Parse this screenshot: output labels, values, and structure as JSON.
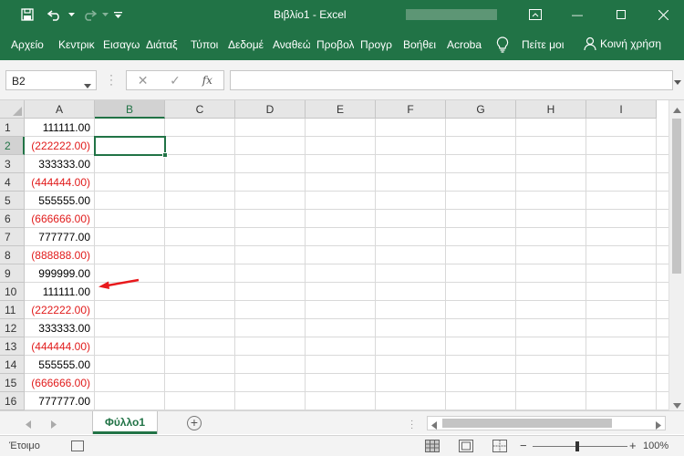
{
  "titlebar": {
    "title": "Βιβλίο1  -  Excel",
    "minimize_glyph": "—",
    "icons": [
      "save-icon",
      "undo-icon",
      "redo-icon",
      "customize-qat-icon",
      "ribbon-display-icon",
      "minimize-icon",
      "maximize-icon",
      "close-icon"
    ]
  },
  "ribbon": {
    "tabs": [
      "Αρχείο",
      "Κεντρικ",
      "Εισαγω",
      "Διάταξ",
      "Τύποι",
      "Δεδομέ",
      "Αναθεώ",
      "Προβολ",
      "Προγρ",
      "Βοήθει",
      "Acroba"
    ],
    "tell_me": "Πείτε μοι",
    "share": "Κοινή χρήση"
  },
  "formula_bar": {
    "name_box": "B2",
    "fx": "fx",
    "value": ""
  },
  "grid": {
    "columns": [
      "A",
      "B",
      "C",
      "D",
      "E",
      "F",
      "G",
      "H",
      "I"
    ],
    "selected_column": "B",
    "selected_row": 2,
    "rows": [
      {
        "n": "1",
        "a": "111111.00",
        "negative": false
      },
      {
        "n": "2",
        "a": "(222222.00)",
        "negative": true
      },
      {
        "n": "3",
        "a": "333333.00",
        "negative": false
      },
      {
        "n": "4",
        "a": "(444444.00)",
        "negative": true
      },
      {
        "n": "5",
        "a": "555555.00",
        "negative": false
      },
      {
        "n": "6",
        "a": "(666666.00)",
        "negative": true
      },
      {
        "n": "7",
        "a": "777777.00",
        "negative": false
      },
      {
        "n": "8",
        "a": "(888888.00)",
        "negative": true
      },
      {
        "n": "9",
        "a": "999999.00",
        "negative": false
      },
      {
        "n": "10",
        "a": "111111.00",
        "negative": false
      },
      {
        "n": "11",
        "a": "(222222.00)",
        "negative": true
      },
      {
        "n": "12",
        "a": "333333.00",
        "negative": false
      },
      {
        "n": "13",
        "a": "(444444.00)",
        "negative": true
      },
      {
        "n": "14",
        "a": "555555.00",
        "negative": false
      },
      {
        "n": "15",
        "a": "(666666.00)",
        "negative": true
      },
      {
        "n": "16",
        "a": "777777.00",
        "negative": false
      }
    ],
    "negative_color": "#e11b1b",
    "annotation_arrow_color": "#e8191c"
  },
  "sheets": {
    "tabs": [
      "Φύλλο1"
    ],
    "add_glyph": "+"
  },
  "status": {
    "ready": "Έτοιμο",
    "zoom_minus": "−",
    "zoom_plus": "+",
    "zoom": "100%"
  },
  "colors": {
    "accent": "#217346"
  }
}
